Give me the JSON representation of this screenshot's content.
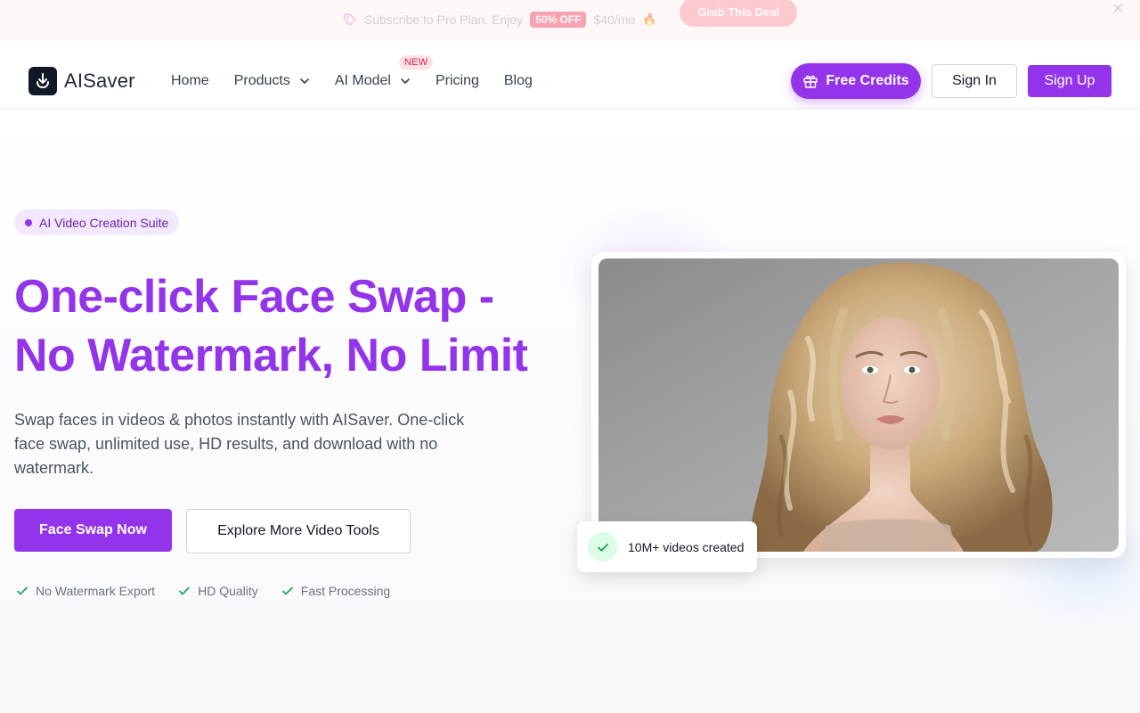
{
  "promo": {
    "text": "Subscribe to Pro Plan. Enjoy",
    "discount": "50% OFF",
    "price": "$40/mo",
    "cta": "Grab This Deal",
    "close": "✕"
  },
  "header": {
    "logo_text": "AISaver",
    "nav": [
      {
        "label": "Home",
        "dropdown": false
      },
      {
        "label": "Products",
        "dropdown": true
      },
      {
        "label": "AI Model",
        "dropdown": true,
        "badge": "NEW"
      },
      {
        "label": "Pricing",
        "dropdown": false
      },
      {
        "label": "Blog",
        "dropdown": false
      }
    ],
    "free_credits": "Free Credits",
    "sign_in": "Sign In",
    "sign_up": "Sign Up"
  },
  "hero": {
    "pill": "AI Video Creation Suite",
    "headline": "One-click Face Swap - No Watermark, No Limit",
    "subtext": "Swap faces in videos & photos instantly with AISaver. One-click face swap, unlimited use, HD results, and download with no watermark.",
    "primary_cta": "Face Swap Now",
    "secondary_cta": "Explore More Video Tools",
    "features": [
      "No Watermark Export",
      "HD Quality",
      "Fast Processing"
    ],
    "stat": "10M+ videos created"
  },
  "colors": {
    "brand": "#9333ea",
    "brand_light": "#f3e8ff",
    "check_green": "#16a34a",
    "promo_red": "#f43f5e"
  },
  "icons": {
    "promo": "tag-icon",
    "credits": "gift-icon",
    "feature": "check-icon"
  }
}
